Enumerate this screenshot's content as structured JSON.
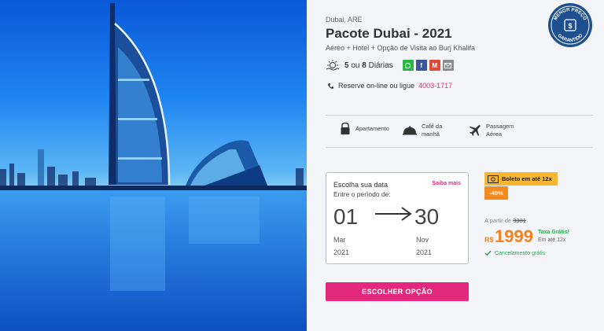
{
  "location": "Dubai, ARE",
  "title": "Pacote Dubai - 2021",
  "subtitle": "Aéreo + Hotel + Opção de Visita ao Burj Khalifa",
  "days": {
    "a": "5",
    "ou": "ou",
    "b": "8",
    "label": "Diárias"
  },
  "share": [
    {
      "icon": "whatsapp-icon",
      "color": "#2cb742"
    },
    {
      "icon": "facebook-icon",
      "color": "#3b5998",
      "text": "f"
    },
    {
      "icon": "gmail-icon",
      "color": "#dd4b39",
      "text": "M"
    },
    {
      "icon": "email-icon",
      "color": "#8d8d8d"
    }
  ],
  "reserve": {
    "text": "Reserve on-line ou ligue",
    "phone": "4003-1717"
  },
  "badge": {
    "top": "MENOR PREÇO",
    "bottom": "GARANTIDO",
    "color": "#1d4f91"
  },
  "amenities": [
    {
      "icon": "apartment-icon",
      "label1": "Apartamento",
      "label2": ""
    },
    {
      "icon": "breakfast-icon",
      "label1": "Café da",
      "label2": "manhã"
    },
    {
      "icon": "airplane-icon",
      "label1": "Passagem",
      "label2": "Aérea"
    }
  ],
  "dates": {
    "label": "Escolha sua data",
    "saiba": "Saiba mais",
    "period": "Entre o período de:",
    "from_day": "01",
    "from_month": "Mar",
    "from_year": "2021",
    "to_day": "30",
    "to_month": "Nov",
    "to_year": "2021"
  },
  "promo": {
    "boleto": "Boleto em até 12x",
    "discount": "-40%"
  },
  "price": {
    "from_label": "A partir de",
    "old": "3331",
    "currency": "R$",
    "value": "1999",
    "taxa": "Taxa Grátis!",
    "installments": "Em até 12x",
    "cancel": "Cancelamento grátis"
  },
  "cta": "ESCOLHER OPÇÃO",
  "colors": {
    "accent": "#e3297e",
    "price": "#f5821f",
    "green": "#2aa552",
    "boleto": "#f5b731"
  }
}
